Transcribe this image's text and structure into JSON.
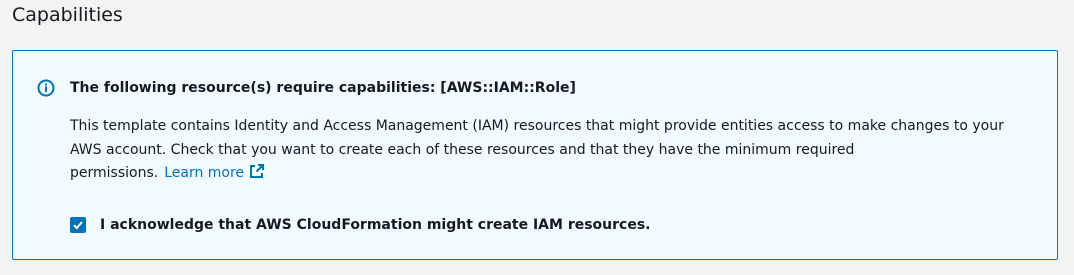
{
  "section": {
    "title": "Capabilities"
  },
  "alert": {
    "icon": "info-icon",
    "heading": "The following resource(s) require capabilities: [AWS::IAM::Role]",
    "body": "This template contains Identity and Access Management (IAM) resources that might provide entities access to make changes to your AWS account. Check that you want to create each of these resources and that they have the minimum required permissions.",
    "learn_more_label": "Learn more",
    "learn_more_icon": "external-link-icon",
    "colors": {
      "border": "#0073bb",
      "background": "#f1faff",
      "link": "#0073bb"
    }
  },
  "acknowledgement": {
    "checked": true,
    "label": "I acknowledge that AWS CloudFormation might create IAM resources."
  }
}
